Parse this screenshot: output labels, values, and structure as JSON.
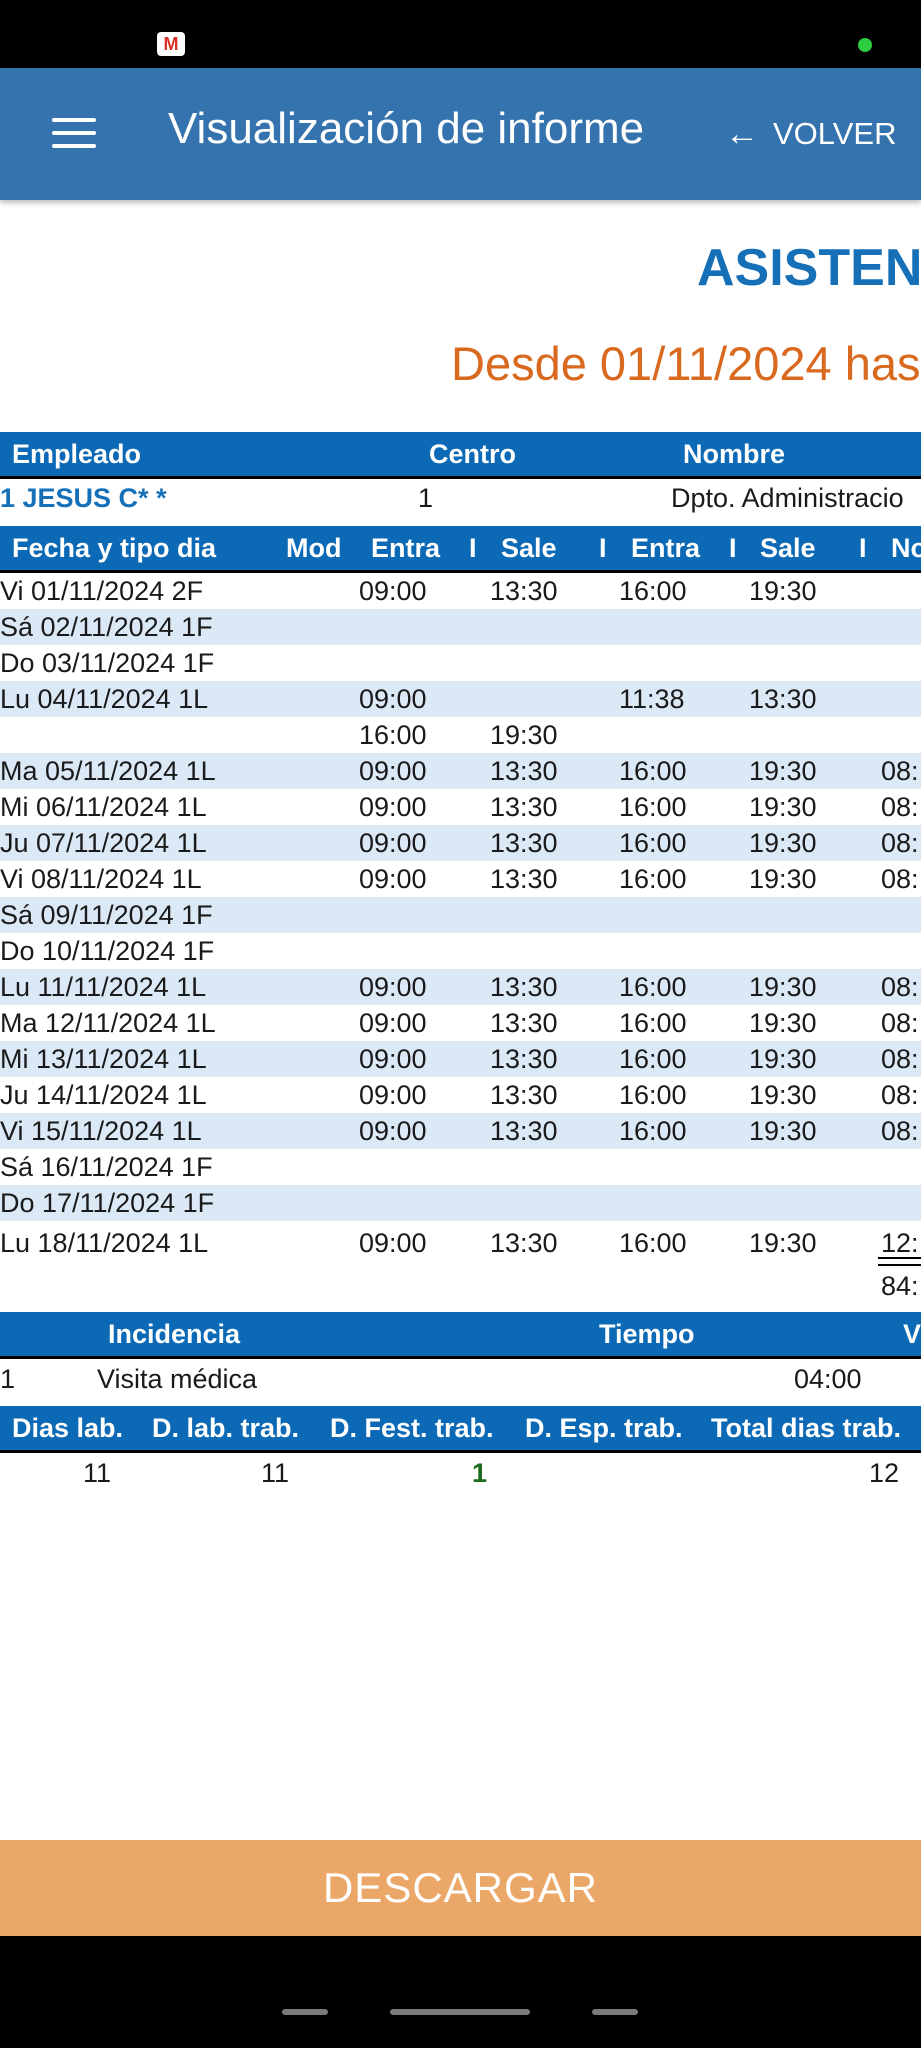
{
  "appbar": {
    "title": "Visualización de informe",
    "back_label": "VOLVER"
  },
  "report": {
    "title": "ASISTENC",
    "range": "Desde 01/11/2024 has",
    "employee_header": {
      "empleado": "Empleado",
      "centro": "Centro",
      "nombre": "Nombre"
    },
    "employee": {
      "name": "1 JESUS C* *",
      "centro": "1",
      "nombre": "Dpto. Administracio"
    },
    "day_header": {
      "fecha": "Fecha y tipo dia",
      "mod": "Mod",
      "entra1": "Entra",
      "i1": "I",
      "sale1": "Sale",
      "i2": "I",
      "entra2": "Entra",
      "i3": "I",
      "sale2": "Sale",
      "i4": "I",
      "no": "No"
    },
    "days": [
      {
        "fecha": "Vi 01/11/2024 2F",
        "entra1": "09:00",
        "sale1": "13:30",
        "entra2": "16:00",
        "sale2": "19:30",
        "extra": ""
      },
      {
        "fecha": "Sá 02/11/2024 1F",
        "entra1": "",
        "sale1": "",
        "entra2": "",
        "sale2": "",
        "extra": ""
      },
      {
        "fecha": "Do 03/11/2024 1F",
        "entra1": "",
        "sale1": "",
        "entra2": "",
        "sale2": "",
        "extra": ""
      },
      {
        "fecha": "Lu 04/11/2024 1L",
        "entra1": "09:00",
        "sale1": "",
        "entra2": "11:38",
        "sale2": "13:30",
        "extra": ""
      },
      {
        "fecha": "",
        "entra1": "16:00",
        "sale1": "19:30",
        "entra2": "",
        "sale2": "",
        "extra": ""
      },
      {
        "fecha": "Ma 05/11/2024 1L",
        "entra1": "09:00",
        "sale1": "13:30",
        "entra2": "16:00",
        "sale2": "19:30",
        "extra": "08:"
      },
      {
        "fecha": "Mi 06/11/2024 1L",
        "entra1": "09:00",
        "sale1": "13:30",
        "entra2": "16:00",
        "sale2": "19:30",
        "extra": "08:"
      },
      {
        "fecha": "Ju 07/11/2024 1L",
        "entra1": "09:00",
        "sale1": "13:30",
        "entra2": "16:00",
        "sale2": "19:30",
        "extra": "08:"
      },
      {
        "fecha": "Vi 08/11/2024 1L",
        "entra1": "09:00",
        "sale1": "13:30",
        "entra2": "16:00",
        "sale2": "19:30",
        "extra": "08:"
      },
      {
        "fecha": "Sá 09/11/2024 1F",
        "entra1": "",
        "sale1": "",
        "entra2": "",
        "sale2": "",
        "extra": ""
      },
      {
        "fecha": "Do 10/11/2024 1F",
        "entra1": "",
        "sale1": "",
        "entra2": "",
        "sale2": "",
        "extra": ""
      },
      {
        "fecha": "Lu 11/11/2024 1L",
        "entra1": "09:00",
        "sale1": "13:30",
        "entra2": "16:00",
        "sale2": "19:30",
        "extra": "08:"
      },
      {
        "fecha": "Ma 12/11/2024 1L",
        "entra1": "09:00",
        "sale1": "13:30",
        "entra2": "16:00",
        "sale2": "19:30",
        "extra": "08:"
      },
      {
        "fecha": "Mi 13/11/2024 1L",
        "entra1": "09:00",
        "sale1": "13:30",
        "entra2": "16:00",
        "sale2": "19:30",
        "extra": "08:"
      },
      {
        "fecha": "Ju 14/11/2024 1L",
        "entra1": "09:00",
        "sale1": "13:30",
        "entra2": "16:00",
        "sale2": "19:30",
        "extra": "08:"
      },
      {
        "fecha": "Vi 15/11/2024 1L",
        "entra1": "09:00",
        "sale1": "13:30",
        "entra2": "16:00",
        "sale2": "19:30",
        "extra": "08:"
      },
      {
        "fecha": "Sá 16/11/2024 1F",
        "entra1": "",
        "sale1": "",
        "entra2": "",
        "sale2": "",
        "extra": ""
      },
      {
        "fecha": "Do 17/11/2024 1F",
        "entra1": "",
        "sale1": "",
        "entra2": "",
        "sale2": "",
        "extra": ""
      },
      {
        "fecha": "Lu 18/11/2024 1L",
        "entra1": "09:00",
        "sale1": "13:30",
        "entra2": "16:00",
        "sale2": "19:30",
        "extra": "12:"
      }
    ],
    "total": "84:",
    "incidence_header": {
      "incidencia": "Incidencia",
      "tiempo": "Tiempo",
      "v": "V"
    },
    "incidence": {
      "code": "1",
      "name": "Visita médica",
      "tiempo": "04:00"
    },
    "summary_header": {
      "dias_lab": "Dias lab.",
      "d_lab_trab": "D. lab. trab.",
      "d_fest_trab": "D. Fest. trab.",
      "d_esp_trab": "D. Esp. trab.",
      "total_dias_trab": "Total dias trab."
    },
    "summary": {
      "dias_lab": "11",
      "d_lab_trab": "11",
      "d_fest_trab": "1",
      "d_esp_trab": "",
      "total_dias_trab": "12"
    }
  },
  "download_label": "DESCARGAR",
  "icons": {
    "menu": "menu-icon",
    "back": "arrow-left-icon",
    "gmail": "gmail-icon"
  },
  "colors": {
    "appbar": "#3473ad",
    "header": "#0b69b5",
    "stripe": "#dbe9f7",
    "title": "#1670b8",
    "range": "#d9691f",
    "download": "#eba768",
    "festive": "#1e6b1e"
  }
}
